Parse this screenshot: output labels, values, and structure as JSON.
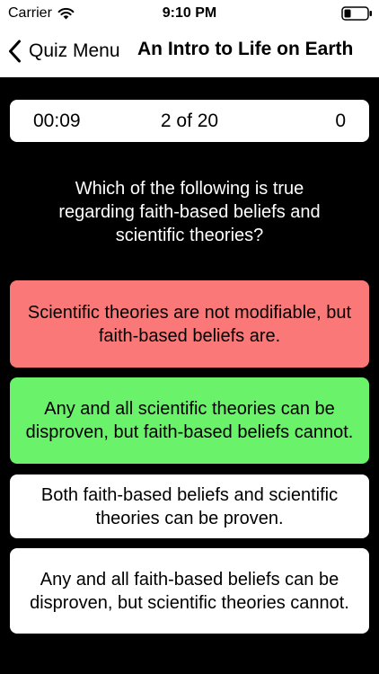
{
  "status_bar": {
    "carrier": "Carrier",
    "time": "9:10 PM",
    "icons": [
      "wifi-icon",
      "battery-icon"
    ]
  },
  "nav": {
    "back_label": "Quiz Menu",
    "title": "An Intro to Life on Earth",
    "back_icon": "chevron-left-icon"
  },
  "scoreboard": {
    "timer": "00:09",
    "progress": "2 of 20",
    "score": "0"
  },
  "question": "Which of the following is true regarding faith-based beliefs and scientific theories?",
  "answers": [
    {
      "text": "Scientific theories are not modifiable, but faith-based beliefs are.",
      "state": "incorrect",
      "color": "#fb7878"
    },
    {
      "text": "Any and all scientific theories can be disproven, but faith-based beliefs cannot.",
      "state": "correct",
      "color": "#6af26a"
    },
    {
      "text": "Both faith-based beliefs and scientific theories can be proven.",
      "state": "neutral",
      "color": "#ffffff"
    },
    {
      "text": "Any and all faith-based beliefs can be disproven, but scientific theories cannot.",
      "state": "neutral",
      "color": "#ffffff"
    }
  ],
  "colors": {
    "background": "#000000",
    "header": "#ffffff",
    "incorrect": "#fb7878",
    "correct": "#6af26a"
  }
}
